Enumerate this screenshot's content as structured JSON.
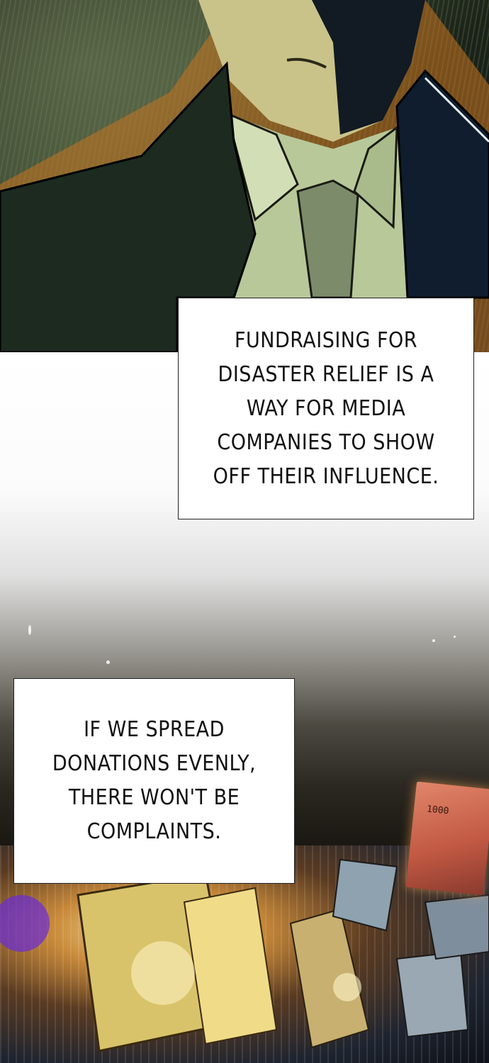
{
  "captions": [
    {
      "text": "FUNDRAISING FOR DISASTER RELIEF IS A WAY FOR MEDIA COMPANIES TO SHOW OFF THEIR INFLUENCE."
    },
    {
      "text": "IF WE SPREAD DONATIONS EVENLY, THERE WON'T BE COMPLAINTS."
    }
  ],
  "banknote": {
    "value": "1000"
  },
  "colors": {
    "suit": "#1c2a20",
    "shirt": "#b9c99a",
    "tie": "#7c8c6a",
    "money_glow": "#f7e7a0"
  }
}
